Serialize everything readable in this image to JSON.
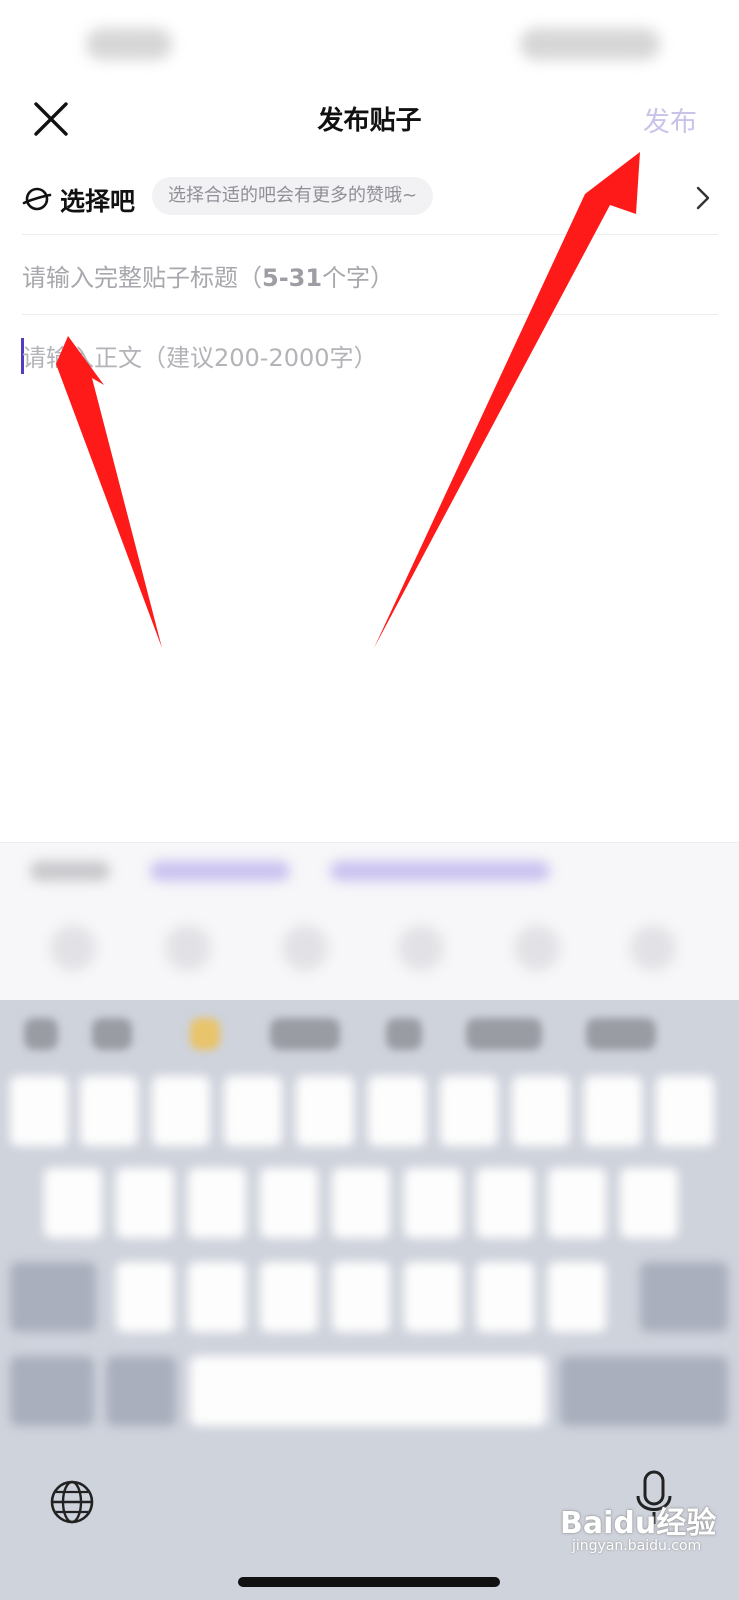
{
  "header": {
    "title": "发布贴子",
    "publish_label": "发布"
  },
  "forum": {
    "label": "选择吧",
    "tip": "选择合适的吧会有更多的赞哦~"
  },
  "title_input": {
    "placeholder_prefix": "请输入完整贴子标题（",
    "placeholder_range": "5-31",
    "placeholder_suffix": "个字）"
  },
  "body_input": {
    "placeholder": "请输入正文（建议200-2000字）"
  },
  "watermark": {
    "text": "Baidu经验",
    "sub": "jingyan.baidu.com"
  },
  "colors": {
    "accent": "#4f3fc0",
    "publish_disabled": "#c9c3ea",
    "arrow": "#ff1a1a"
  },
  "icons": {
    "close": "close-icon",
    "forum": "planet-icon",
    "chevron": "chevron-right-icon",
    "globe": "globe-icon",
    "mic": "microphone-icon"
  }
}
